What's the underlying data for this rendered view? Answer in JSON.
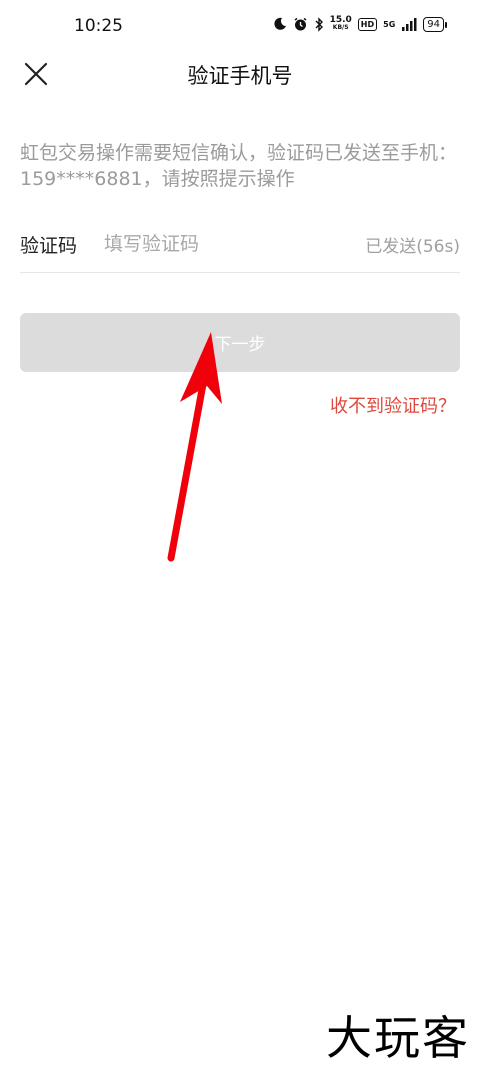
{
  "status_bar": {
    "time": "10:25",
    "speed_value": "15.0",
    "speed_unit": "KB/S",
    "hd": "HD",
    "network": "5G",
    "battery": "94"
  },
  "header": {
    "title": "验证手机号"
  },
  "description": "虹包交易操作需要短信确认，验证码已发送至手机：159****6881，请按照提示操作",
  "code_field": {
    "label": "验证码",
    "placeholder": "填写验证码",
    "value": "",
    "countdown": "已发送(56s)"
  },
  "next_button": {
    "label": "下一步"
  },
  "help_link": "收不到验证码？",
  "watermark": "大玩客",
  "colors": {
    "accent_red": "#e0483d",
    "button_disabled": "#dcdcdc",
    "arrow": "#f0000a"
  }
}
